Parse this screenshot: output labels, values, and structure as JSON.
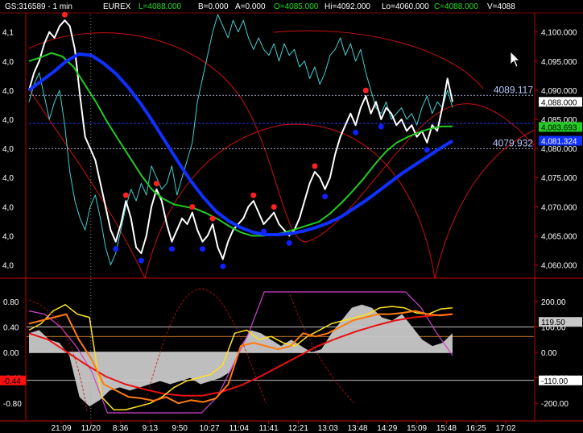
{
  "header": {
    "symbol": "GS:316589 - 1 min",
    "exchange": "EUREX",
    "last": "L=4088.000",
    "bid": "B=0.000",
    "ask": "A=0.000",
    "open": "O=4085.000",
    "high": "Hi=4092.000",
    "low": "Lo=4060.000",
    "close": "C=4088.000",
    "volume": "V=4088"
  },
  "colors": {
    "background": "#000000",
    "price": "#ffffff",
    "ma_fast": "#22cc22",
    "ma_slow": "#1030ff",
    "cyan_series": "#40d0d0",
    "envelope": "#cc1010",
    "pivot_high": "#ff2020",
    "pivot_low": "#1020ff",
    "osc_yellow": "#ffe020",
    "osc_orange": "#ff7a10",
    "osc_red": "#e81010",
    "osc_magenta": "#d040d0",
    "histogram": "#c8c8c8",
    "axis_text": "#ffffff",
    "frame": "#c00000"
  },
  "chart_data": [
    {
      "type": "line",
      "title": "GS:316589 - 1 min",
      "x_ticks": [
        "21:09",
        "11/20",
        "8:36",
        "9:13",
        "9:50",
        "10:27",
        "11:04",
        "11:41",
        "12:21",
        "13:03",
        "13:48",
        "14:29",
        "15:09",
        "15:48",
        "16:25",
        "17:02"
      ],
      "right_axis": {
        "ticks": [
          "4,100.000",
          "4,095.000",
          "4,090.000",
          "4,085.000",
          "4,080.000",
          "4,075.000",
          "4,070.000",
          "4,065.000",
          "4,060.000"
        ],
        "ylim": [
          4058,
          4103
        ],
        "grid": false
      },
      "left_axis_ticks": [
        "4,1",
        "4,0",
        "4,0",
        "4,0",
        "4,0",
        "4,0",
        "4,0",
        "4,0",
        "4,0"
      ],
      "reference_lines": [
        {
          "label": "4089.117",
          "value": 4089.117
        },
        {
          "label": "4079.932",
          "value": 4079.932
        }
      ],
      "price_tags": [
        {
          "label": "4,088.000",
          "value": 4088.0,
          "color": "#ffffff",
          "text_color": "#000000"
        },
        {
          "label": "4,083.693",
          "value": 4083.693,
          "color": "#22cc22",
          "text_color": "#000000"
        },
        {
          "label": "4,081.324",
          "value": 4081.324,
          "color": "#1030ff",
          "text_color": "#ffffff"
        }
      ],
      "series": [
        {
          "role": "price",
          "color": "#ffffff",
          "values": [
            4090,
            4093,
            4095,
            4098,
            4100,
            4099,
            4101,
            4102,
            4101,
            4097,
            4089,
            4082,
            4080,
            4078,
            4074,
            4070,
            4066,
            4064,
            4067,
            4071,
            4068,
            4063,
            4062,
            4065,
            4070,
            4073,
            4071,
            4067,
            4064,
            4066,
            4068,
            4067,
            4069,
            4066,
            4064,
            4065,
            4067,
            4063,
            4061,
            4064,
            4066,
            4067,
            4068,
            4070,
            4071,
            4069,
            4067,
            4068,
            4069,
            4067,
            4066,
            4065,
            4066,
            4068,
            4071,
            4074,
            4076,
            4075,
            4073,
            4075,
            4079,
            4082,
            4084,
            4086,
            4084,
            4087,
            4089,
            4086,
            4088,
            4085,
            4087,
            4086,
            4084,
            4085,
            4083,
            4084,
            4082,
            4083,
            4081,
            4084,
            4083,
            4087,
            4092,
            4088
          ]
        },
        {
          "role": "cyan",
          "color": "#40d0d0",
          "values": [
            4088,
            4091,
            4093,
            4089,
            4085,
            4088,
            4090,
            4084,
            4076,
            4071,
            4068,
            4066,
            4070,
            4072,
            4068,
            4063,
            4060,
            4062,
            4066,
            4070,
            4073,
            4071,
            4074,
            4072,
            4077,
            4075,
            4073,
            4074,
            4077,
            4072,
            4075,
            4078,
            4081,
            4088,
            4092,
            4096,
            4100,
            4103,
            4101,
            4099,
            4102,
            4100,
            4102,
            4099,
            4097,
            4099,
            4097,
            4096,
            4098,
            4095,
            4098,
            4096,
            4097,
            4094,
            4095,
            4092,
            4094,
            4091,
            4093,
            4096,
            4097,
            4099,
            4096,
            4098,
            4095,
            4097,
            4093,
            4090,
            4087,
            4086,
            4088,
            4085,
            4086,
            4087,
            4085,
            4086,
            4084,
            4087,
            4089,
            4086,
            4088,
            4087,
            4090,
            4087
          ]
        },
        {
          "role": "ma_fast",
          "color": "#22cc22",
          "values": [
            4095,
            4095.6,
            4096.4,
            4095.8,
            4094,
            4091,
            4088,
            4084.6,
            4081.6,
            4078.6,
            4075.6,
            4073,
            4071.4,
            4070.4,
            4070,
            4069.6,
            4068.8,
            4067.8,
            4066.6,
            4065.6,
            4065,
            4065,
            4065.2,
            4065.6,
            4066.2,
            4066.8,
            4067.4,
            4068.8,
            4070.6,
            4072.6,
            4074.8,
            4077.2,
            4079.4,
            4081,
            4082,
            4082.8,
            4083.4,
            4083.8,
            4083.8
          ]
        },
        {
          "role": "ma_slow",
          "color": "#1030ff",
          "values": [
            4090,
            4091.6,
            4093.2,
            4095,
            4096.2,
            4096,
            4094.6,
            4092.8,
            4090.4,
            4087.6,
            4084.4,
            4081,
            4077.6,
            4074.4,
            4071.6,
            4069.2,
            4067.6,
            4066.4,
            4065.6,
            4065.2,
            4065.2,
            4065.4,
            4065.8,
            4066.4,
            4067.2,
            4068.2,
            4069.6,
            4071,
            4072.6,
            4074.2,
            4075.8,
            4077.2,
            4078.6,
            4080,
            4081.3
          ]
        }
      ],
      "pivot_highs": [
        4100,
        4100,
        4077,
        4074,
        4070,
        4068,
        4066,
        4069,
        4068,
        4067,
        4075,
        4085,
        4090,
        4086,
        4086
      ]
    },
    {
      "type": "line",
      "left_axis": {
        "ticks": [
          "0.80",
          "0.40",
          "0.00",
          "-0.40",
          "-0.80"
        ],
        "ylim": [
          -1.0,
          1.0
        ],
        "current_tag": "-0.44"
      },
      "right_axis": {
        "ticks": [
          "200.00",
          "100.00",
          "0.00",
          "-100.00",
          "-200.00"
        ],
        "ylim": [
          -250,
          250
        ]
      },
      "value_tags": [
        {
          "label": "119.50",
          "value": 119.5,
          "color": "#c8c8c8",
          "text_color": "#000000"
        },
        {
          "label": "-110.00",
          "value": -110,
          "color": "#ffffff",
          "text_color": "#000000"
        }
      ],
      "series": [
        {
          "role": "histogram",
          "color": "#c8c8c8",
          "values": [
            0.3,
            0.35,
            0.2,
            0.15,
            -0.05,
            -0.7,
            -0.85,
            -0.75,
            -0.6,
            -0.55,
            -0.6,
            -0.55,
            -0.5,
            -0.45,
            -0.5,
            -0.45,
            -0.4,
            -0.5,
            -0.45,
            -0.4,
            -0.3,
            0.1,
            0.35,
            0.3,
            0.2,
            0.1,
            0.2,
            0.1,
            0.0,
            0.05,
            0.3,
            0.5,
            0.7,
            0.75,
            0.7,
            0.55,
            0.5,
            0.6,
            0.4,
            0.2,
            0.1,
            0.15,
            0.3
          ]
        },
        {
          "role": "yellow",
          "color": "#ffe020",
          "values": [
            0.35,
            0.45,
            0.65,
            0.75,
            0.6,
            0.55,
            -0.7,
            -0.9,
            -0.9,
            -0.85,
            -0.8,
            -0.7,
            -0.55,
            -0.45,
            -0.4,
            -0.35,
            -0.2,
            0.3,
            0.35,
            0.2,
            0.25,
            0.15,
            0.1,
            0.25,
            0.35,
            0.45,
            0.5,
            0.55,
            0.6,
            0.7,
            0.72,
            0.7,
            0.62,
            0.6,
            0.68,
            0.7
          ]
        },
        {
          "role": "orange",
          "color": "#ff7a10",
          "values": [
            0.45,
            0.5,
            0.55,
            0.6,
            0.2,
            -0.1,
            -0.5,
            -0.6,
            -0.7,
            -0.72,
            -0.76,
            -0.7,
            -0.8,
            -0.75,
            -0.78,
            -0.72,
            -0.5,
            0.1,
            0.15,
            0.1,
            0.05,
            0.1,
            0.3,
            0.25,
            0.3,
            0.4,
            0.5,
            0.55,
            0.6,
            0.6,
            0.62,
            0.65,
            0.6,
            0.58,
            0.6
          ]
        },
        {
          "role": "red",
          "color": "#e81010",
          "values": [
            0.3,
            0.2,
            0.0,
            -0.2,
            -0.38,
            -0.5,
            -0.58,
            -0.65,
            -0.68,
            -0.68,
            -0.62,
            -0.52,
            -0.38,
            -0.22,
            -0.06,
            0.1,
            0.22,
            0.33,
            0.42,
            0.5,
            0.55,
            0.58,
            0.6
          ]
        },
        {
          "role": "magenta",
          "color": "#d040d0",
          "values": [
            0.65,
            0.6,
            0.4,
            0.1,
            -0.3,
            -0.95,
            -0.95,
            -0.95,
            -0.95,
            -0.95,
            -0.95,
            -0.95,
            -0.7,
            -0.2,
            0.3,
            0.95,
            0.95,
            0.95,
            0.95,
            0.95,
            0.95,
            0.95,
            0.95,
            0.95,
            0.95,
            0.7,
            0.3,
            -0.05
          ]
        }
      ]
    }
  ]
}
